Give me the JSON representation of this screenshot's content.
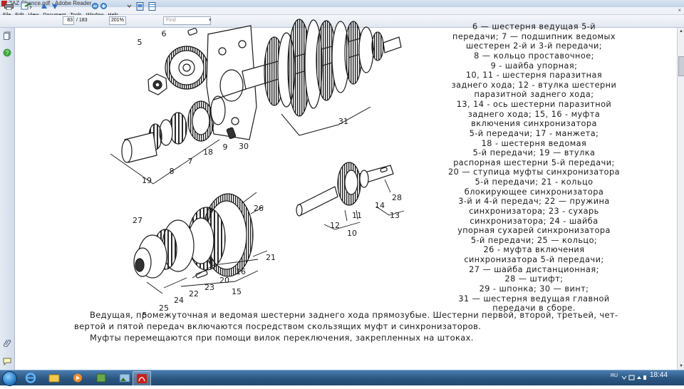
{
  "window": {
    "title": "ZAZ Chance.pdf - Adobe Reader"
  },
  "menu": [
    "File",
    "Edit",
    "View",
    "Document",
    "Tools",
    "Window",
    "Help"
  ],
  "toolbar": {
    "page_current": "83",
    "page_total": "/ 183",
    "zoom": "201%",
    "find_placeholder": "Find"
  },
  "legend_lines": [
    "6 — шестерня ведущая 5-й",
    "передачи; 7 — подшипник ведомых",
    "шестерен 2-й и 3-й передачи;",
    "8 — кольцо проставочное;",
    "9 - шайба упорная;",
    "10, 11 - шестерня паразитная",
    "заднего хода; 12 - втулка шестерни",
    "паразитной заднего хода;",
    "13, 14 - ось шестерни паразитной",
    "заднего хода; 15, 16 - муфта",
    "включения синхронизатора",
    "5-й передачи; 17 - манжета;",
    "18 - шестерня ведомая",
    "5-й передачи; 19 — втулка",
    "распорная шестерни 5-й передачи;",
    "20 — ступица муфты синхронизатора",
    "5-й передачи; 21 - кольцо",
    "блокирующее синхронизатора",
    "3-й и 4-й передач; 22 — пружина",
    "синхронизатора; 23 - сухарь",
    "синхронизатора; 24 - шайба",
    "упорная сухарей синхронизатора",
    "5-й передачи; 25 — кольцо;",
    "26 - муфта включения",
    "синхронизатора 5-й передачи;",
    "27 — шайба дистанционная;",
    "28 — штифт;",
    "29 - шпонка; 30 — винт;",
    "31 — шестерня ведущая главной",
    "передачи в сборе."
  ],
  "body_paragraph": [
    "Ведущая, промежуточная и ведомая шестерни заднего хода прямозубые. Шестерни первой, второй, третьей, чет-",
    "вертой и пятой передач включаются посредством скользящих муфт и синхронизаторов.",
    "Муфты перемещаются при помощи вилок переключения, закрепленных на штоках."
  ],
  "figure_labels": [
    {
      "text": "6"
    },
    {
      "text": "5"
    },
    {
      "text": "31"
    },
    {
      "text": "18"
    },
    {
      "text": "9"
    },
    {
      "text": "30"
    },
    {
      "text": "8"
    },
    {
      "text": "7"
    },
    {
      "text": "19"
    },
    {
      "text": "28"
    },
    {
      "text": "14"
    },
    {
      "text": "11"
    },
    {
      "text": "12"
    },
    {
      "text": "13"
    },
    {
      "text": "10"
    },
    {
      "text": "27"
    },
    {
      "text": "26"
    },
    {
      "text": "21"
    },
    {
      "text": "16"
    },
    {
      "text": "20"
    },
    {
      "text": "23"
    },
    {
      "text": "22"
    },
    {
      "text": "24"
    },
    {
      "text": "15"
    },
    {
      "text": "25"
    },
    {
      "text": "5"
    }
  ],
  "taskbar": {
    "lang": "RU",
    "time": "18:44"
  },
  "colors": {
    "taskbar": "#2a5580",
    "titlebar": "#c4d4e8",
    "ink": "#1c1c1c"
  }
}
